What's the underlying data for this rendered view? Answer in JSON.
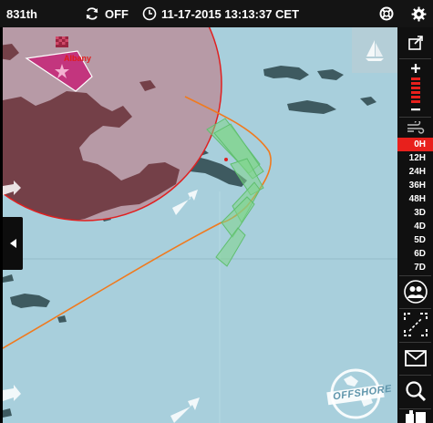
{
  "topbar": {
    "rank": "831th",
    "sync_state": "OFF",
    "datetime": "11-17-2015 13:13:37 CET"
  },
  "map": {
    "boat_name": "Albany",
    "logo_text": "OFFSHORE",
    "colors": {
      "sea": "#a8cfdc",
      "land": "#3e5a60",
      "zone": "#b79aa6",
      "zone_land": "#744048",
      "zone_border": "#e02020",
      "route": "#f07a1e",
      "ghost_boat": "#7fd68a",
      "player_boat": "#c42a7a"
    }
  },
  "sidebar": {
    "time_options": [
      "0H",
      "12H",
      "24H",
      "36H",
      "48H",
      "3D",
      "4D",
      "5D",
      "6D",
      "7D"
    ],
    "active_time": "0H"
  }
}
